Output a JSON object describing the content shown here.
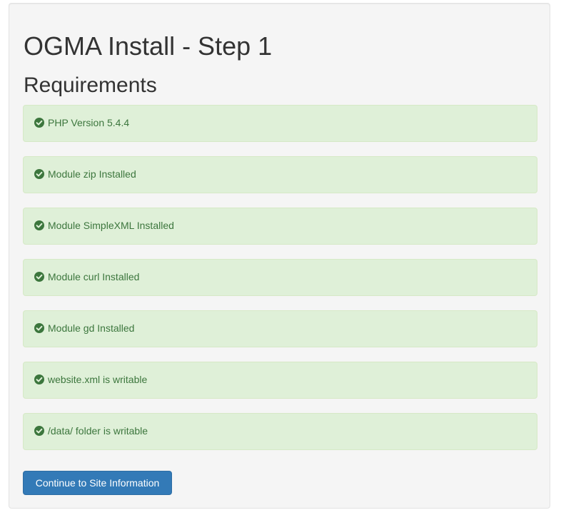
{
  "page": {
    "title": "OGMA Install - Step 1",
    "section_heading": "Requirements"
  },
  "requirements": [
    {
      "label": "PHP Version 5.4.4",
      "status": "ok",
      "icon": "check-circle-icon"
    },
    {
      "label": "Module zip Installed",
      "status": "ok",
      "icon": "check-circle-icon"
    },
    {
      "label": "Module SimpleXML Installed",
      "status": "ok",
      "icon": "check-circle-icon"
    },
    {
      "label": "Module curl Installed",
      "status": "ok",
      "icon": "check-circle-icon"
    },
    {
      "label": "Module gd Installed",
      "status": "ok",
      "icon": "check-circle-icon"
    },
    {
      "label": "website.xml is writable",
      "status": "ok",
      "icon": "check-circle-icon"
    },
    {
      "label": "/data/ folder is writable",
      "status": "ok",
      "icon": "check-circle-icon"
    }
  ],
  "actions": {
    "continue_label": "Continue to Site Information"
  },
  "colors": {
    "success_bg": "#dff0d8",
    "success_text": "#3c763d",
    "primary": "#337ab7"
  }
}
